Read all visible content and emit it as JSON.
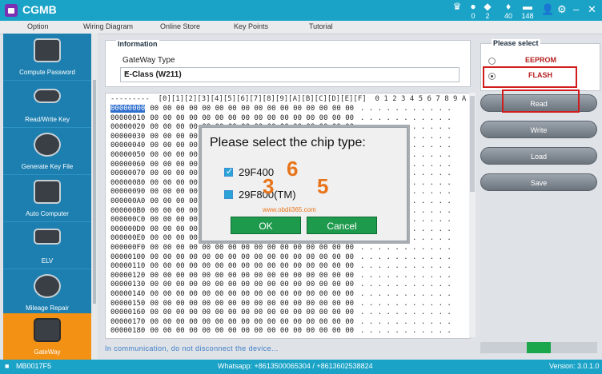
{
  "app": {
    "title": "CGMB"
  },
  "titlebar": {
    "counters": [
      {
        "icon": "crown-icon",
        "value": ""
      },
      {
        "icon": "trophy-icon",
        "value": "0"
      },
      {
        "icon": "diamond-icon",
        "value": "2"
      },
      {
        "icon": "gem-icon",
        "value": "40"
      },
      {
        "icon": "coin-icon",
        "value": "148"
      }
    ]
  },
  "menu": {
    "items": [
      "Option",
      "Wiring Diagram",
      "Online Store",
      "Key Points",
      "Tutorial"
    ]
  },
  "sidebar": {
    "items": [
      {
        "label": "Compute Password",
        "icon": "computer-icon"
      },
      {
        "label": "Read/Write Key",
        "icon": "key-icon"
      },
      {
        "label": "Generate Key File",
        "icon": "key-fob-icon"
      },
      {
        "label": "Auto Computer",
        "icon": "ecu-icon"
      },
      {
        "label": "ELV",
        "icon": "steering-lock-icon"
      },
      {
        "label": "Mileage Repair",
        "icon": "speedometer-icon"
      },
      {
        "label": "GateWay",
        "icon": "gateway-icon"
      }
    ]
  },
  "information": {
    "title": "Information",
    "gateway_label": "GateWay Type",
    "gateway_value": "E-Class  (W211)"
  },
  "hex": {
    "header": "---------  [0][1][2][3][4][5][6][7][8][9][A][B][C][D][E][F]  0 1 2 3 4 5 6 7 8 9 A",
    "byte_row": "00 00 00 00 00 00 00 00 00 00 00 00 00 00 00 00",
    "ascii_row": ". . . . . . . . . . .",
    "addresses": [
      "00000000",
      "00000010",
      "00000020",
      "00000030",
      "00000040",
      "00000050",
      "00000060",
      "00000070",
      "00000080",
      "00000090",
      "000000A0",
      "000000B0",
      "000000C0",
      "000000D0",
      "000000E0",
      "000000F0",
      "00000100",
      "00000110",
      "00000120",
      "00000130",
      "00000140",
      "00000150",
      "00000160",
      "00000170",
      "00000180"
    ]
  },
  "select": {
    "title": "Please select",
    "options": [
      {
        "label": "EEPROM",
        "checked": false
      },
      {
        "label": "FLASH",
        "checked": true
      }
    ]
  },
  "actions": {
    "read": "Read",
    "write": "Write",
    "load": "Load",
    "save": "Save"
  },
  "dialog": {
    "title": "Please select the chip type:",
    "chips": [
      {
        "label": "29F400",
        "checked": true
      },
      {
        "label": "29F800(TM)",
        "checked": false
      }
    ],
    "ok": "OK",
    "cancel": "Cancel"
  },
  "watermark": {
    "num1": "3",
    "num2": "6",
    "num3": "5",
    "url": "www.obdii365.com"
  },
  "status": {
    "message": "In communication, do not disconnect the device...",
    "progress": 0.4,
    "device": "MB0017F5",
    "contact": "Whatsapp: +8613500065304 / +8613602538824",
    "version": "Version: 3.0.1.0"
  }
}
